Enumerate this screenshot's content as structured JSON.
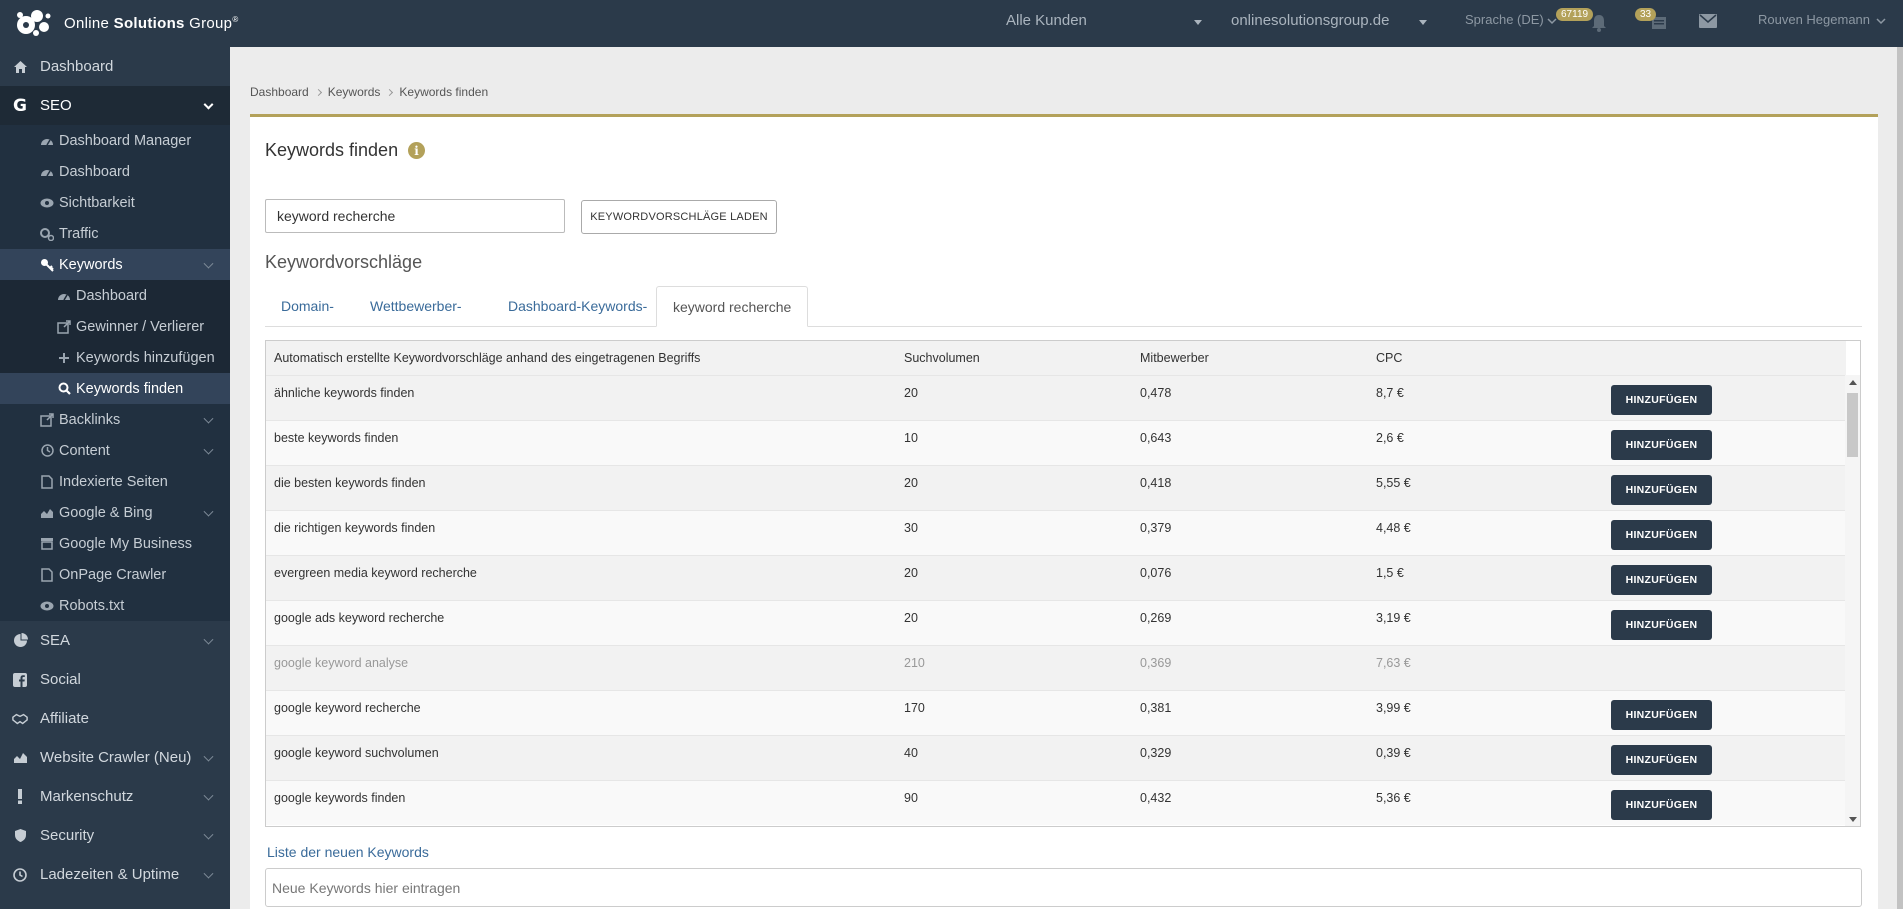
{
  "brand": {
    "name_part1": "Online ",
    "name_part2": "Solutions",
    "name_part3": " Group",
    "trademark": "®"
  },
  "topbar": {
    "customer_select": "Alle Kunden",
    "domain_select": "onlinesolutionsgroup.de",
    "language": "Sprache (DE)",
    "notifications_count": "67119",
    "messages_count": "33",
    "user_name": "Rouven Hegemann"
  },
  "sidebar": {
    "dashboard": "Dashboard",
    "seo": "SEO",
    "seo_items": {
      "dashboard_manager": "Dashboard Manager",
      "dashboard": "Dashboard",
      "sichtbarkeit": "Sichtbarkeit",
      "traffic": "Traffic",
      "keywords": "Keywords",
      "keywords_sub": {
        "dashboard": "Dashboard",
        "gewinner": "Gewinner / Verlierer",
        "hinzufuegen": "Keywords hinzufügen",
        "finden": "Keywords finden"
      },
      "backlinks": "Backlinks",
      "content": "Content",
      "indexierte": "Indexierte Seiten",
      "google_bing": "Google & Bing",
      "gmb": "Google My Business",
      "onpage": "OnPage Crawler",
      "robots": "Robots.txt"
    },
    "sea": "SEA",
    "social": "Social",
    "affiliate": "Affiliate",
    "website_crawler": "Website Crawler (Neu)",
    "markenschutz": "Markenschutz",
    "security": "Security",
    "ladezeiten": "Ladezeiten & Uptime"
  },
  "breadcrumb": [
    "Dashboard",
    "Keywords",
    "Keywords finden"
  ],
  "page": {
    "title": "Keywords finden",
    "search_value": "keyword recherche",
    "load_button": "KEYWORDVORSCHLÄGE LADEN",
    "section_heading": "Keywordvorschläge",
    "tabs": [
      "Domain-",
      "Wettbewerber-",
      "Dashboard-Keywords-",
      "keyword recherche"
    ],
    "active_tab": 3,
    "table": {
      "headers": {
        "keyword": "Automatisch erstellte Keywordvorschläge anhand des eingetragenen Begriffs",
        "volume": "Suchvolumen",
        "competitors": "Mitbewerber",
        "cpc": "CPC"
      },
      "add_label": "HINZUFÜGEN",
      "rows": [
        {
          "keyword": "ähnliche keywords finden",
          "volume": "20",
          "competitors": "0,478",
          "cpc": "8,7 €",
          "added": false
        },
        {
          "keyword": "beste keywords finden",
          "volume": "10",
          "competitors": "0,643",
          "cpc": "2,6 €",
          "added": false
        },
        {
          "keyword": "die besten keywords finden",
          "volume": "20",
          "competitors": "0,418",
          "cpc": "5,55 €",
          "added": false
        },
        {
          "keyword": "die richtigen keywords finden",
          "volume": "30",
          "competitors": "0,379",
          "cpc": "4,48 €",
          "added": false
        },
        {
          "keyword": "evergreen media keyword recherche",
          "volume": "20",
          "competitors": "0,076",
          "cpc": "1,5 €",
          "added": false
        },
        {
          "keyword": "google ads keyword recherche",
          "volume": "20",
          "competitors": "0,269",
          "cpc": "3,19 €",
          "added": false
        },
        {
          "keyword": "google keyword analyse",
          "volume": "210",
          "competitors": "0,369",
          "cpc": "7,63 €",
          "added": true
        },
        {
          "keyword": "google keyword recherche",
          "volume": "170",
          "competitors": "0,381",
          "cpc": "3,99 €",
          "added": false
        },
        {
          "keyword": "google keyword suchvolumen",
          "volume": "40",
          "competitors": "0,329",
          "cpc": "0,39 €",
          "added": false
        },
        {
          "keyword": "google keywords finden",
          "volume": "90",
          "competitors": "0,432",
          "cpc": "5,36 €",
          "added": false
        }
      ]
    },
    "new_keywords_label": "Liste der neuen Keywords",
    "new_keywords_placeholder": "Neue Keywords hier eintragen"
  },
  "colors": {
    "sidebar_bg": "#2b3a4a",
    "accent_gold": "#b3a15a",
    "link_blue": "#3a6b9a"
  }
}
